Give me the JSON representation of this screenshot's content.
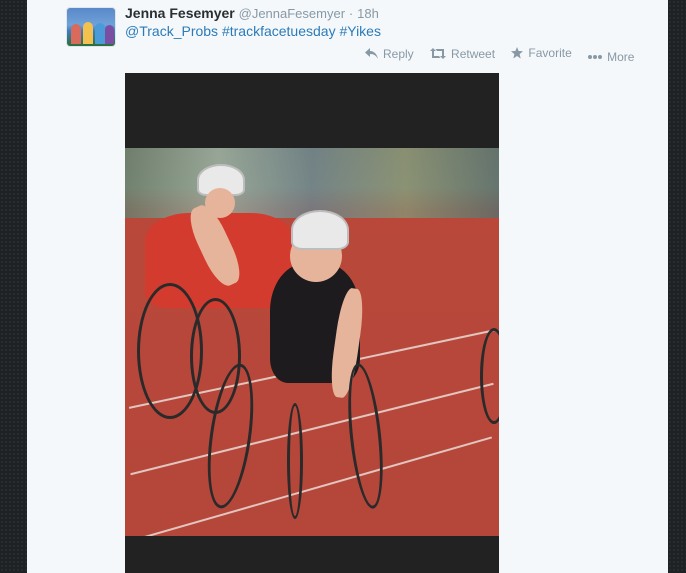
{
  "tweet": {
    "name": "Jenna Fesemyer",
    "handle": "@JennaFesemyer",
    "separator": "·",
    "time": "18h",
    "text_mention": "@Track_Probs",
    "text_hashtag1": "#trackfacetuesday",
    "text_hashtag2": "#Yikes"
  },
  "actions": {
    "reply": "Reply",
    "retweet": "Retweet",
    "favorite": "Favorite",
    "more": "More"
  },
  "icons": [
    "reply-icon",
    "retweet-icon",
    "star-icon",
    "more-dots-icon"
  ],
  "colors": {
    "link": "#2b7bb9",
    "name": "#292f33",
    "meta": "#8899a6",
    "card_bg": "#f5f8fa",
    "page_bg": "#1f2224"
  }
}
